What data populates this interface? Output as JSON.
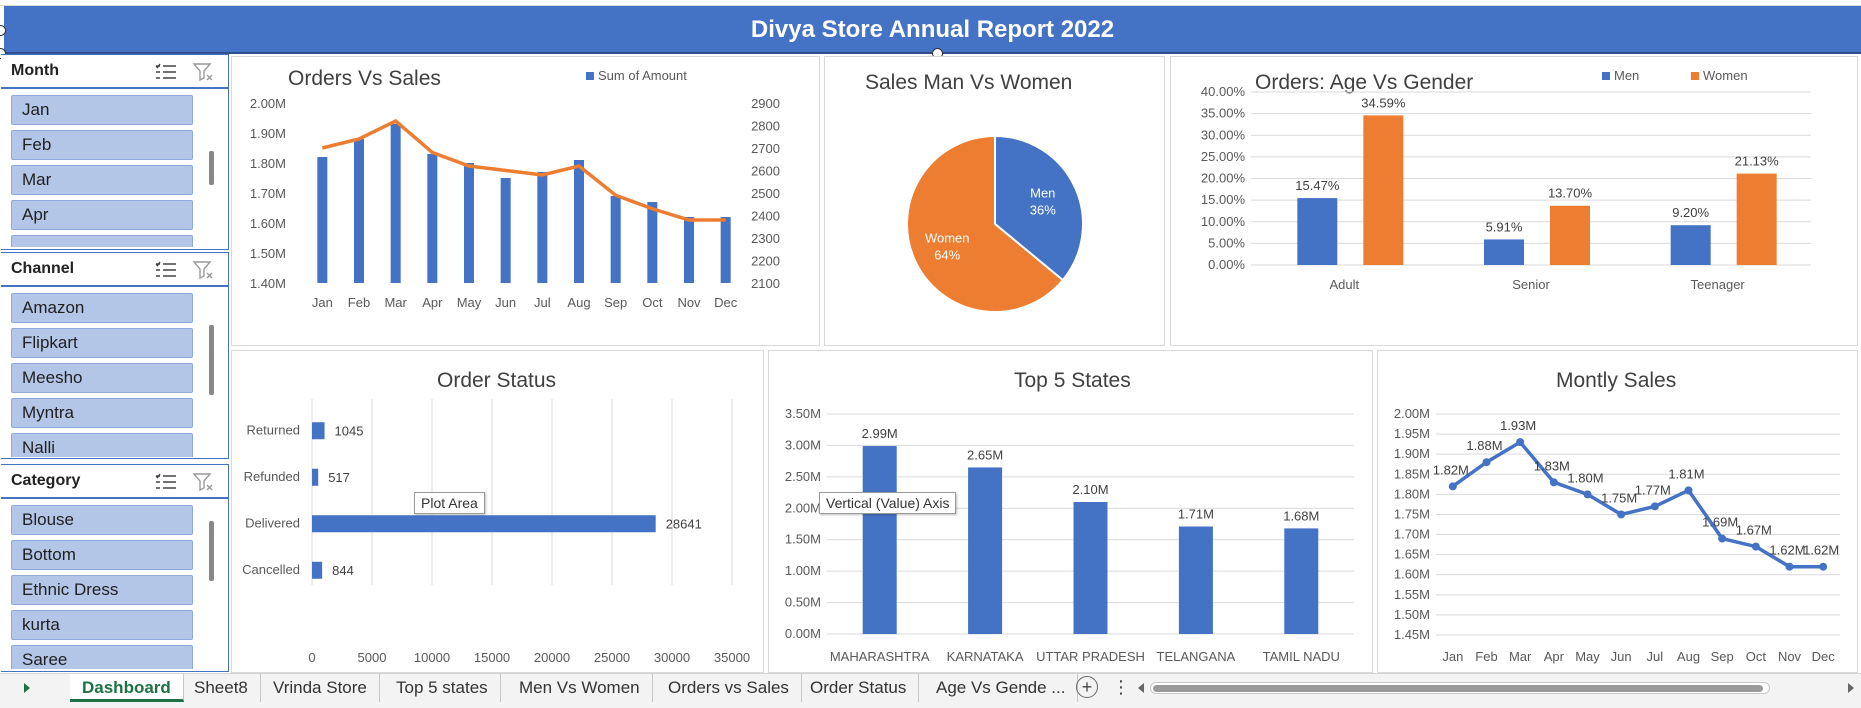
{
  "report_title": "Divya Store Annual Report 2022",
  "slicers": [
    {
      "title": "Month",
      "items": [
        "Jan",
        "Feb",
        "Mar",
        "Apr"
      ]
    },
    {
      "title": "Channel",
      "items": [
        "Amazon",
        "Flipkart",
        "Meesho",
        "Myntra",
        "Nalli"
      ]
    },
    {
      "title": "Category",
      "items": [
        "Blouse",
        "Bottom",
        "Ethnic Dress",
        "kurta",
        "Saree"
      ]
    }
  ],
  "tooltips": {
    "plot_area": "Plot Area",
    "vertical_axis": "Vertical (Value) Axis"
  },
  "tabs": [
    "Dashboard",
    "Sheet8",
    "Vrinda Store",
    "Top 5 states",
    "Men Vs Women",
    "Orders vs Sales",
    "Order Status",
    "Age Vs Gende ..."
  ],
  "active_tab": "Dashboard",
  "tab_more": "⋮",
  "tab_add": "+",
  "colors": {
    "blue": "#4472c4",
    "orange": "#ed7d31",
    "grid": "#d9d9d9",
    "slicer_item": "#b4c6e7"
  },
  "chart_data": [
    {
      "id": "orders-vs-sales",
      "type": "bar",
      "title": "Orders Vs Sales",
      "legend": "Sum of Amount",
      "legend_position": "top-right",
      "categories": [
        "Jan",
        "Feb",
        "Mar",
        "Apr",
        "May",
        "Jun",
        "Jul",
        "Aug",
        "Sep",
        "Oct",
        "Nov",
        "Dec"
      ],
      "series": [
        {
          "name": "Sum of Amount",
          "type": "bar",
          "axis": "left",
          "values": [
            1.82,
            1.88,
            1.93,
            1.83,
            1.8,
            1.75,
            1.77,
            1.81,
            1.69,
            1.67,
            1.62,
            1.62
          ]
        },
        {
          "type": "line",
          "axis": "right",
          "values": [
            2700,
            2740,
            2820,
            2680,
            2620,
            2600,
            2580,
            2620,
            2490,
            2430,
            2380,
            2380
          ]
        }
      ],
      "yticks_left": [
        "1.40M",
        "1.50M",
        "1.60M",
        "1.70M",
        "1.80M",
        "1.90M",
        "2.00M"
      ],
      "ylim_left": [
        1.4,
        2.0
      ],
      "yticks_right": [
        "2100",
        "2200",
        "2300",
        "2400",
        "2500",
        "2600",
        "2700",
        "2800",
        "2900"
      ],
      "ylim_right": [
        2100,
        2900
      ],
      "grid": false
    },
    {
      "id": "sales-men-women",
      "type": "pie",
      "title": "Sales Man Vs Women",
      "slices": [
        {
          "label": "Men",
          "value": 36,
          "text": "36%",
          "color": "#4472c4"
        },
        {
          "label": "Women",
          "value": 64,
          "text": "64%",
          "color": "#ed7d31"
        }
      ]
    },
    {
      "id": "age-vs-gender",
      "type": "bar",
      "title": "Orders: Age Vs Gender",
      "legend_position": "top-right",
      "categories": [
        "Adult",
        "Senior",
        "Teenager"
      ],
      "series": [
        {
          "name": "Men",
          "values": [
            15.47,
            5.91,
            9.2
          ],
          "labels": [
            "15.47%",
            "5.91%",
            "9.20%"
          ],
          "color": "#4472c4"
        },
        {
          "name": "Women",
          "values": [
            34.59,
            13.7,
            21.13
          ],
          "labels": [
            "34.59%",
            "13.70%",
            "21.13%"
          ],
          "color": "#ed7d31"
        }
      ],
      "yticks": [
        "0.00%",
        "5.00%",
        "10.00%",
        "15.00%",
        "20.00%",
        "25.00%",
        "30.00%",
        "35.00%",
        "40.00%"
      ],
      "ylim": [
        0,
        40
      ],
      "grid": true
    },
    {
      "id": "order-status",
      "type": "bar",
      "orientation": "horizontal",
      "title": "Order Status",
      "categories": [
        "Returned",
        "Refunded",
        "Delivered",
        "Cancelled"
      ],
      "values": [
        1045,
        517,
        28641,
        844
      ],
      "labels": [
        "1045",
        "517",
        "28641",
        "844"
      ],
      "xticks": [
        "0",
        "5000",
        "10000",
        "15000",
        "20000",
        "25000",
        "30000",
        "35000"
      ],
      "xlim": [
        0,
        35000
      ],
      "grid": true
    },
    {
      "id": "top-5-states",
      "type": "bar",
      "title": "Top 5 States",
      "categories": [
        "MAHARASHTRA",
        "KARNATAKA",
        "UTTAR PRADESH",
        "TELANGANA",
        "TAMIL NADU"
      ],
      "values": [
        2.99,
        2.65,
        2.1,
        1.71,
        1.68
      ],
      "labels": [
        "2.99M",
        "2.65M",
        "2.10M",
        "1.71M",
        "1.68M"
      ],
      "yticks": [
        "0.00M",
        "0.50M",
        "1.00M",
        "1.50M",
        "2.00M",
        "2.50M",
        "3.00M",
        "3.50M"
      ],
      "ylim": [
        0,
        3.5
      ],
      "grid": true
    },
    {
      "id": "monthly-sales",
      "type": "line",
      "title": "Montly Sales",
      "categories": [
        "Jan",
        "Feb",
        "Mar",
        "Apr",
        "May",
        "Jun",
        "Jul",
        "Aug",
        "Sep",
        "Oct",
        "Nov",
        "Dec"
      ],
      "values": [
        1.82,
        1.88,
        1.93,
        1.83,
        1.8,
        1.75,
        1.77,
        1.81,
        1.69,
        1.67,
        1.62,
        1.62
      ],
      "labels": [
        "1.82M",
        "1.88M",
        "1.93M",
        "1.83M",
        "1.80M",
        "1.75M",
        "1.77M",
        "1.81M",
        "1.69M",
        "1.67M",
        "1.62M",
        "1.62M"
      ],
      "yticks": [
        "1.45M",
        "1.50M",
        "1.55M",
        "1.60M",
        "1.65M",
        "1.70M",
        "1.75M",
        "1.80M",
        "1.85M",
        "1.90M",
        "1.95M",
        "2.00M"
      ],
      "ylim": [
        1.45,
        2.0
      ],
      "grid": true
    }
  ]
}
